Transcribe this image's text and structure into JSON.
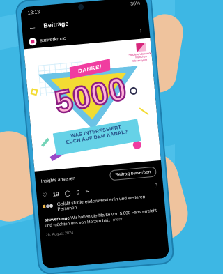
{
  "status": {
    "time": "13:13",
    "battery": "36%"
  },
  "header": {
    "title": "Beiträge"
  },
  "account": {
    "name": "stuwerkmuc"
  },
  "post_graphic": {
    "banner": "DANKE!",
    "number": "5000",
    "question_line1": "WAS INTERESSIERT",
    "question_line2": "EUCH AUF DEM KANAL?",
    "logo_text_1": "Studierendenwerk",
    "logo_text_2": "München Oberbayern"
  },
  "actions": {
    "insights_label": "Insights ansehen",
    "boost_label": "Beitrag bewerben",
    "like_count": "19",
    "comment_count": "6"
  },
  "liked_by": {
    "text": "Gefällt studierendenwerkberlin und weiteren Personen"
  },
  "caption": {
    "username": "stuwerkmuc",
    "text": "Wir haben die Marke von 5.000 Fans erreicht und möchten uns von Herzen bei...",
    "more": "mehr"
  },
  "date": "26. August 2024",
  "colors": {
    "background": "#3db7e4",
    "phone": "#2f9fd2",
    "brand_pink": "#d7267b",
    "highlight_yellow": "#f3dc33",
    "highlight_cyan": "#66d2e7"
  },
  "icons": {
    "back": "arrow-left",
    "more": "vertical-dots",
    "like": "heart",
    "comment": "speech-bubble",
    "share": "paper-plane",
    "save": "bookmark"
  }
}
